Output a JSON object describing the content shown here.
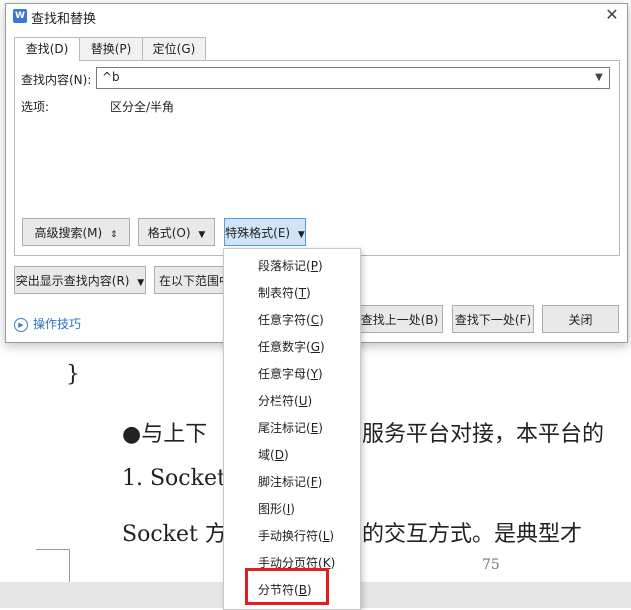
{
  "dialog": {
    "title": "查找和替换",
    "close_glyph": "✕",
    "logo_text": "W",
    "tabs": [
      {
        "label": "查找(D)",
        "active": true
      },
      {
        "label": "替换(P)",
        "active": false
      },
      {
        "label": "定位(G)",
        "active": false
      }
    ],
    "find_label": "查找内容(N):",
    "find_value": "^b",
    "options_label": "选项:",
    "options_value": "区分全/半角",
    "buttons": {
      "advanced": "高级搜索(M)",
      "advanced_arrow": "⇕",
      "format": "格式(O)",
      "special": "特殊格式(E)",
      "caret": "▼",
      "highlight": "突出显示查找内容(R)",
      "find_in": "在以下范围中",
      "find_prev": "查找上一处(B)",
      "find_next": "查找下一处(F)",
      "close": "关闭"
    },
    "help": "操作技巧"
  },
  "special_menu": {
    "items": [
      {
        "text": "段落标记(",
        "key": "P",
        "end": ")"
      },
      {
        "text": "制表符(",
        "key": "T",
        "end": ")"
      },
      {
        "text": "任意字符(",
        "key": "C",
        "end": ")"
      },
      {
        "text": "任意数字(",
        "key": "G",
        "end": ")"
      },
      {
        "text": "任意字母(",
        "key": "Y",
        "end": ")"
      },
      {
        "text": "分栏符(",
        "key": "U",
        "end": ")"
      },
      {
        "text": "尾注标记(",
        "key": "E",
        "end": ")"
      },
      {
        "text": "域(",
        "key": "D",
        "end": ")"
      },
      {
        "text": "脚注标记(",
        "key": "F",
        "end": ")"
      },
      {
        "text": "图形(",
        "key": "I",
        "end": ")"
      },
      {
        "text": "手动换行符(",
        "key": "L",
        "end": ")"
      },
      {
        "text": "手动分页符(",
        "key": "K",
        "end": ")"
      },
      {
        "text": "分节符(",
        "key": "B",
        "end": ")"
      }
    ],
    "highlight_color": "#e02020"
  },
  "document": {
    "brace": "}",
    "bullet_line_left": "●与上下",
    "bullet_line_right": "服务平台对接，本平台的",
    "heading_left": "1. Socket",
    "para_left": "Socket 方",
    "para_right": "的交互方式。是典型才",
    "page_number": "75"
  }
}
